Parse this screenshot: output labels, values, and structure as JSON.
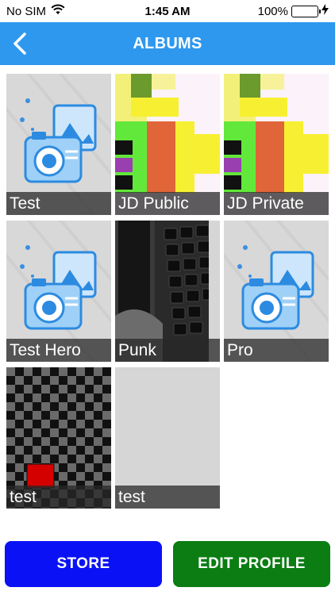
{
  "status_bar": {
    "carrier": "No SIM",
    "time": "1:45 AM",
    "battery": "100%",
    "icons": [
      "wifi-icon",
      "battery-icon",
      "charging-icon"
    ]
  },
  "navbar": {
    "title": "ALBUMS",
    "back_icon": "chevron-left-icon",
    "color": "#2e98ee"
  },
  "albums": [
    {
      "name": "Test",
      "thumb": "placeholder-camera"
    },
    {
      "name": "JD Public",
      "thumb": "pixel-art"
    },
    {
      "name": "JD Private",
      "thumb": "pixel-art"
    },
    {
      "name": "Test Hero",
      "thumb": "placeholder-camera"
    },
    {
      "name": "Punk",
      "thumb": "keyboard-photo"
    },
    {
      "name": "Pro",
      "thumb": "placeholder-camera"
    },
    {
      "name": "test",
      "thumb": "checkerboard"
    },
    {
      "name": "test",
      "thumb": "blank-gray"
    }
  ],
  "buttons": {
    "store": {
      "label": "STORE",
      "color": "#0a12f5"
    },
    "edit_profile": {
      "label": "EDIT PROFILE",
      "color": "#0b7d12"
    }
  }
}
